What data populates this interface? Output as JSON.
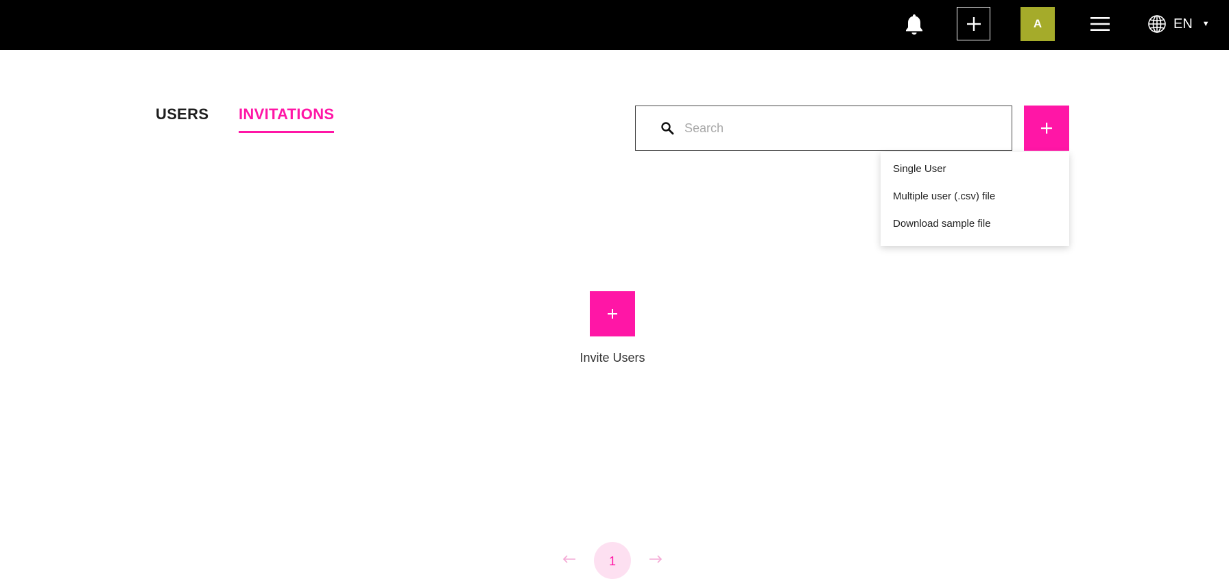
{
  "colors": {
    "accent": "#ff16a6",
    "topbar_bg": "#000000",
    "avatar_bg": "#a5ab2a",
    "page_badge_bg": "#fde0f1"
  },
  "topbar": {
    "bell_icon": "bell-icon",
    "add_icon": "plus-icon",
    "avatar_initial": "A",
    "menu_icon": "hamburger-icon",
    "language": {
      "icon": "globe-icon",
      "label": "EN",
      "caret": "▼"
    }
  },
  "tabs": [
    {
      "label": "USERS",
      "active": false
    },
    {
      "label": "INVITATIONS",
      "active": true
    }
  ],
  "search": {
    "placeholder": "Search",
    "value": ""
  },
  "add_button": {
    "label": "+"
  },
  "dropdown": {
    "items": [
      {
        "label": "Single User"
      },
      {
        "label": "Multiple user (.csv) file"
      },
      {
        "label": "Download sample file"
      }
    ]
  },
  "empty_state": {
    "button_label": "+",
    "caption": "Invite Users"
  },
  "pagination": {
    "prev": "←",
    "current_page": "1",
    "next": "→"
  }
}
